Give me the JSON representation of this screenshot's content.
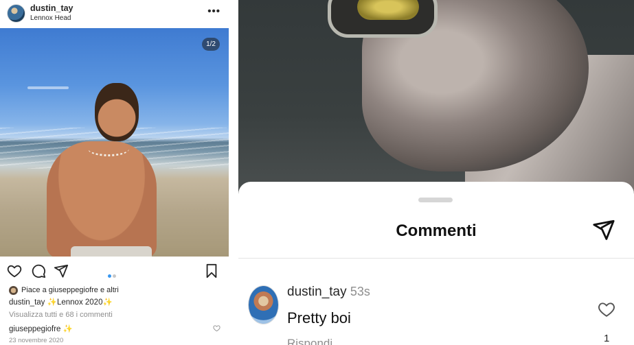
{
  "post": {
    "username": "dustin_tay",
    "location": "Lennox Head",
    "more_icon": "more-horizontal-icon",
    "image_counter": "1/2",
    "likes_text": "Piace a giuseppegiofre e altri",
    "caption_user": "dustin_tay",
    "caption_text": "✨Lennox 2020✨",
    "view_comments": "Visualizza tutti e 68 i commenti",
    "comment_user": "giuseppegiofre",
    "comment_text": "✨",
    "date": "23 novembre 2020",
    "carousel": {
      "count": 2,
      "active": 0
    }
  },
  "comments_sheet": {
    "title": "Commenti",
    "comment": {
      "username": "dustin_tay",
      "time": "53s",
      "text": "Pretty boi",
      "reply_label": "Rispondi",
      "likes": "1"
    }
  },
  "colors": {
    "accent_blue": "#3897f0",
    "text_primary": "#262626",
    "text_secondary": "#8e8e8e"
  }
}
